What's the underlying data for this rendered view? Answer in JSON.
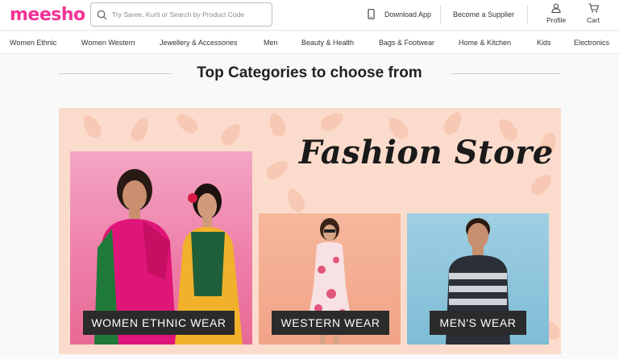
{
  "header": {
    "logo": "meesho",
    "search_placeholder": "Try Saree, Kurti or Search by Product Code",
    "download_app": "Download App",
    "become_supplier": "Become a Supplier",
    "profile": "Profile",
    "cart": "Cart"
  },
  "nav": {
    "items": [
      "Women Ethnic",
      "Women Western",
      "Jewellery & Accessories",
      "Men",
      "Beauty & Health",
      "Bags & Footwear",
      "Home & Kitchen",
      "Kids",
      "Electronics"
    ]
  },
  "section": {
    "title": "Top Categories to choose from"
  },
  "banner": {
    "title": "Fashion Store",
    "cards": [
      {
        "label": "WOMEN ETHNIC WEAR"
      },
      {
        "label": "WESTERN WEAR"
      },
      {
        "label": "MEN'S WEAR"
      }
    ]
  },
  "colors": {
    "brand": "#f43397",
    "banner_bg": "#fbdccc",
    "label_bg": "#2b2b2b"
  },
  "icons": [
    "search-icon",
    "phone-icon",
    "user-icon",
    "cart-icon"
  ]
}
